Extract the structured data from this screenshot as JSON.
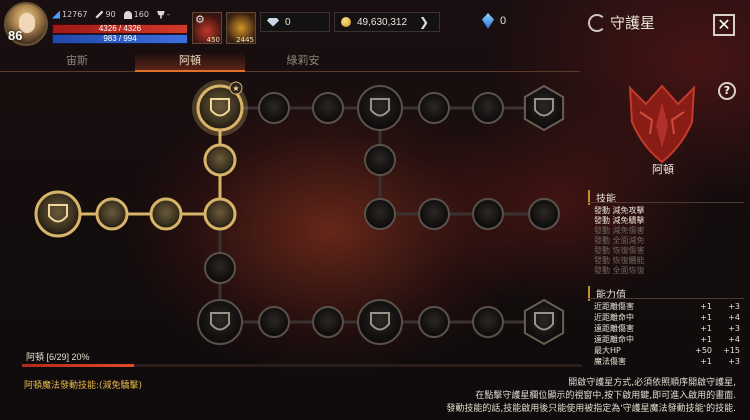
{
  "hud": {
    "level": "86",
    "stat1": "12767",
    "stat2": "90",
    "stat3": "160",
    "stat4": "-",
    "hp_text": "4326 / 4326",
    "mp_text": "983 / 994",
    "potion_count": "450",
    "item_count": "2445",
    "currency1_value": "0",
    "gold_value": "49,630,312",
    "gem_value": "0"
  },
  "header": {
    "title": "守護星",
    "close_label": "✕"
  },
  "tabs": [
    {
      "label": "宙斯"
    },
    {
      "label": "阿頓",
      "active": true
    },
    {
      "label": "綠莉安"
    }
  ],
  "progress": {
    "text": "阿頓 [6/29] 20%",
    "fraction": 0.2
  },
  "footer": {
    "left": "阿頓魔法發動技能:(減免驕擊)",
    "right_lines": [
      "開啟守護星方式,必須依照順序開啟守護星,",
      "在點擊守護星欄位顯示的視窗中,按下啟用鍵,即可進入啟用的畫面.",
      "發動技能的話,技能啟用後只能使用被指定為'守護星魔法發動技能'的技能."
    ]
  },
  "panel": {
    "help_label": "?",
    "emblem_name": "阿頓",
    "skills_title": "技能",
    "skills": [
      {
        "label": "發動 減免攻擊",
        "active": true
      },
      {
        "label": "發動 減免驕擊",
        "active": true
      },
      {
        "label": "發動 減免傷害",
        "active": false
      },
      {
        "label": "發動 全面減免",
        "active": false
      },
      {
        "label": "發動 恢復傷害",
        "active": false
      },
      {
        "label": "發動 恢復體能",
        "active": false
      },
      {
        "label": "發動 全面恢復",
        "active": false
      }
    ],
    "abilities_title": "能力值",
    "abilities": [
      {
        "label": "近距離傷害",
        "v1": "+1",
        "v2": "+3"
      },
      {
        "label": "近距離命中",
        "v1": "+1",
        "v2": "+4"
      },
      {
        "label": "遠距離傷害",
        "v1": "+1",
        "v2": "+3"
      },
      {
        "label": "遠距離命中",
        "v1": "+1",
        "v2": "+4"
      },
      {
        "label": "最大HP",
        "v1": "+50",
        "v2": "+15"
      },
      {
        "label": "魔法傷害",
        "v1": "+1",
        "v2": "+3"
      }
    ]
  },
  "colors": {
    "accent": "#e0702a",
    "gold": "#c8a45a",
    "skill_active": "#e8e2d6",
    "skill_inactive": "#6c665e"
  }
}
